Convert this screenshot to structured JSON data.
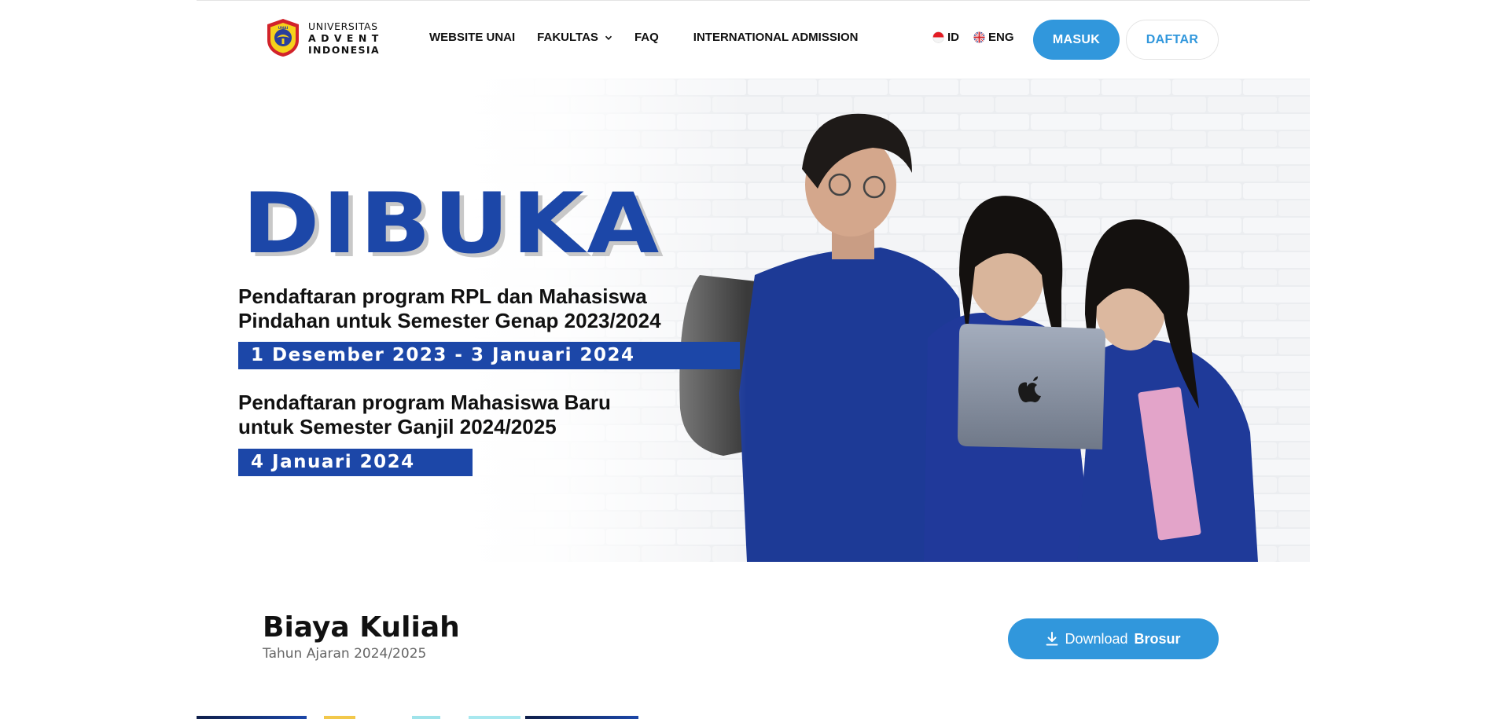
{
  "header": {
    "logo": {
      "line1": "UNIVERSITAS",
      "line2": "ADVENT",
      "line3": "INDONESIA",
      "seal_text": "UNAI"
    },
    "nav": [
      {
        "label": "WEBSITE UNAI"
      },
      {
        "label": "FAKULTAS",
        "icon": "chevron-down-icon"
      },
      {
        "label": "FAQ"
      },
      {
        "label": "INTERNATIONAL ADMISSION"
      }
    ],
    "languages": [
      {
        "label": "ID",
        "icon": "indonesia-flag-icon"
      },
      {
        "label": "ENG",
        "icon": "uk-flag-icon"
      }
    ],
    "login_label": "MASUK",
    "register_label": "DAFTAR"
  },
  "hero": {
    "headline": "DIBUKA",
    "block1": {
      "line1": "Pendaftaran program RPL dan Mahasiswa",
      "line2": "Pindahan untuk Semester Genap 2023/2024",
      "date": "1 Desember 2023 - 3 Januari 2024"
    },
    "block2": {
      "line1": "Pendaftaran program Mahasiswa Baru",
      "line2": "untuk Semester Ganjil 2024/2025",
      "date": "4 Januari 2024"
    }
  },
  "tuition": {
    "title": "Biaya Kuliah",
    "subtitle": "Tahun Ajaran 2024/2025",
    "download_label": "Download",
    "download_label_bold": "Brosur",
    "download_icon": "download-icon"
  },
  "colors": {
    "primary_button": "#3197dc",
    "hero_blue": "#1c47a8",
    "text_dark": "#111111"
  }
}
